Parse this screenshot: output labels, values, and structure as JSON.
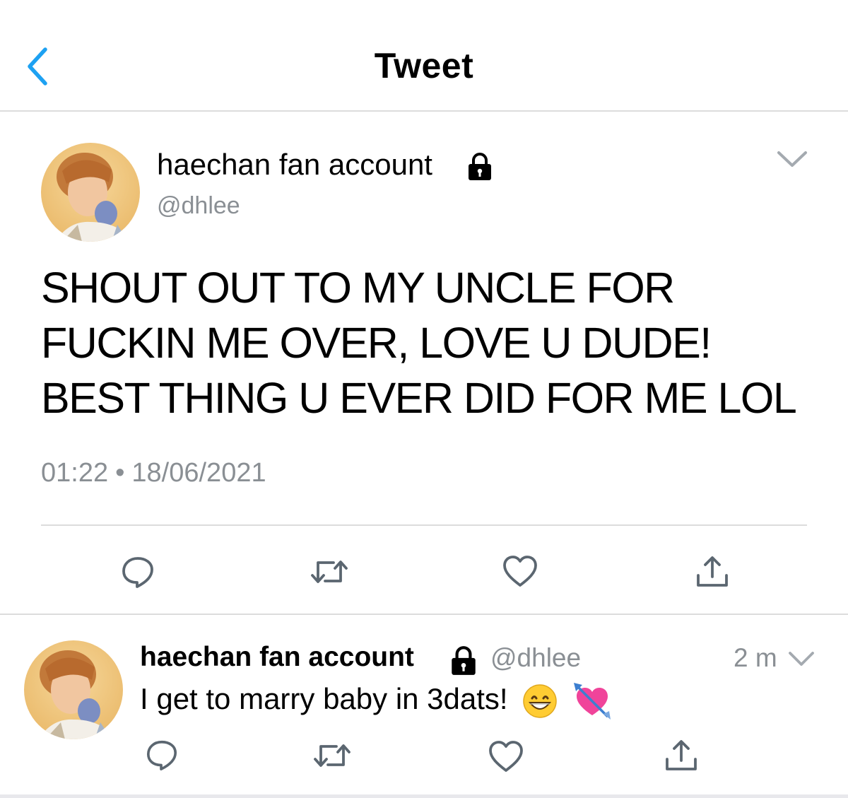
{
  "header": {
    "title": "Tweet"
  },
  "tweet": {
    "display_name": "haechan fan account",
    "handle": "@dhlee",
    "text": "SHOUT OUT TO MY UNCLE FOR FUCKIN ME OVER, LOVE U DUDE! BEST THING U EVER DID FOR ME LOL",
    "time": "01:22",
    "separator": "•",
    "date": "18/06/2021"
  },
  "reply": {
    "display_name": "haechan fan account",
    "handle": "@dhlee",
    "age": "2 m",
    "text": "I get to marry baby in 3dats!",
    "emojis": [
      "grinning-face-emoji",
      "heart-with-arrow-emoji"
    ]
  },
  "icons": {
    "back": "chevron-left-icon",
    "lock": "lock-icon",
    "menu": "chevron-down-icon",
    "actions": [
      "reply-icon",
      "retweet-icon",
      "like-icon",
      "share-icon"
    ]
  },
  "colors": {
    "accent": "#1da1f2",
    "secondary_text": "#8a8f94",
    "icon_gray": "#5b6670",
    "divider": "#dcdcdc"
  }
}
